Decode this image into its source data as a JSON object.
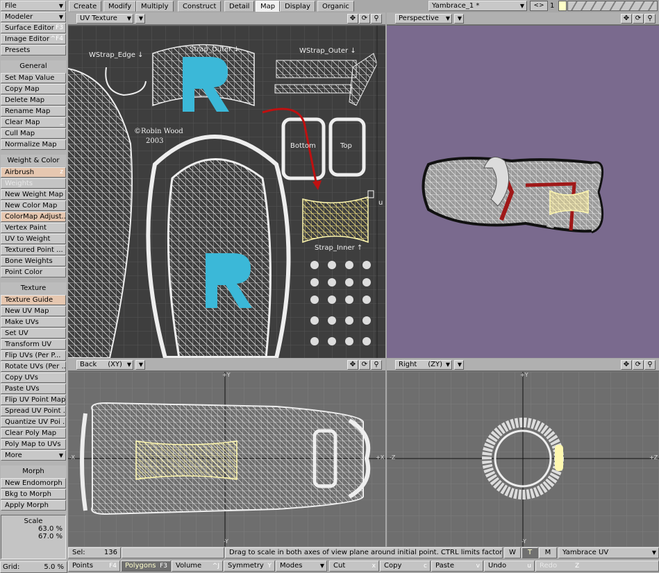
{
  "sidebar": {
    "top": [
      {
        "label": "File",
        "shortcut": ""
      },
      {
        "label": "Modeler",
        "shortcut": ""
      },
      {
        "label": "Surface Editor",
        "shortcut": "F3"
      },
      {
        "label": "Image Editor",
        "shortcut": "^F4"
      },
      {
        "label": "Presets",
        "shortcut": ""
      }
    ],
    "general_header": "General",
    "general": [
      "Set Map Value",
      "Copy Map",
      "Delete Map",
      "Rename Map",
      "Clear Map",
      "Cull Map",
      "Normalize Map"
    ],
    "weight_header": "Weight & Color",
    "weight": [
      "Airbrush",
      "Weights",
      "New Weight Map",
      "New Color Map",
      "ColorMap Adjust...",
      "Vertex Paint",
      "UV to Weight",
      "Textured Point ...",
      "Bone Weights",
      "Point Color"
    ],
    "airbrush_shortcut": "z",
    "clear_map_shortcut": "_",
    "texture_header": "Texture",
    "texture": [
      "Texture Guide",
      "New UV Map",
      "Make UVs",
      "Set UV",
      "Transform UV",
      "Flip UVs (Per P...",
      "Rotate UVs (Per ...",
      "Copy UVs",
      "Paste UVs",
      "Flip UV Point Map",
      "Spread UV Point ...",
      "Quantize UV Poi ...",
      "Clear Poly Map",
      "Poly Map to UVs",
      "More"
    ],
    "morph_header": "Morph",
    "morph": [
      "New Endomorph",
      "Bkg to Morph",
      "Apply Morph"
    ],
    "scale_label": "Scale",
    "scale_x": "63.0 %",
    "scale_y": "67.0 %",
    "grid_label": "Grid:",
    "grid_value": "5.0 %"
  },
  "tabs": [
    "Create",
    "Modify",
    "Multiply",
    "Construct",
    "Detail",
    "Map",
    "Display",
    "Organic"
  ],
  "active_tab": "Map",
  "object": "Yambrace_1 *",
  "layer_number": "1",
  "viewports": {
    "uv": {
      "mode": "UV Texture",
      "labels": {
        "wstrap_edge": "WStrap_Edge ↓",
        "strap_outer": "Strap_Outer ↓",
        "wstrap_outer": "WStrap_Outer ↓",
        "copyright": "©Robin Wood",
        "year": "2003",
        "bottom": "Bottom",
        "top": "Top",
        "strap_inner": "Strap_Inner ↑",
        "u": "u"
      }
    },
    "perspective": {
      "mode": "Perspective"
    },
    "back": {
      "mode": "Back",
      "axis": "(XY)",
      "top_axis": "+Y",
      "bottom_axis": "-Y",
      "left_axis": "-X",
      "right_axis": "+X"
    },
    "right": {
      "mode": "Right",
      "axis": "(ZY)",
      "top_axis": "+Y",
      "bottom_axis": "-Y",
      "left_axis": "-Z",
      "right_axis": "+Z"
    }
  },
  "status": {
    "sel_label": "Sel:",
    "sel_count": "136",
    "message": "Drag to scale in both axes of view plane around initial point. CTRL limits factors.",
    "w": "W",
    "t": "T",
    "m": "M",
    "vmap": "Yambrace UV"
  },
  "bottom_bar": [
    {
      "label": "Points",
      "shortcut": "F4"
    },
    {
      "label": "Polygons",
      "shortcut": "F3"
    },
    {
      "label": "Volume",
      "shortcut": "^J"
    },
    {
      "label": "Symmetry",
      "shortcut": "Y"
    },
    {
      "label": "Modes",
      "shortcut": ""
    },
    {
      "label": "Cut",
      "shortcut": "x"
    },
    {
      "label": "Copy",
      "shortcut": "c"
    },
    {
      "label": "Paste",
      "shortcut": "v"
    },
    {
      "label": "Undo",
      "shortcut": "u"
    },
    {
      "label": "Redo",
      "shortcut": "Z"
    }
  ],
  "colors": {
    "perspective_bg": "#7a6a8e",
    "uv_bg": "#444444",
    "ortho_bg": "#6e6e6e",
    "accent_blue": "#3bb8d8",
    "selection_yellow": "#fff8b0"
  }
}
